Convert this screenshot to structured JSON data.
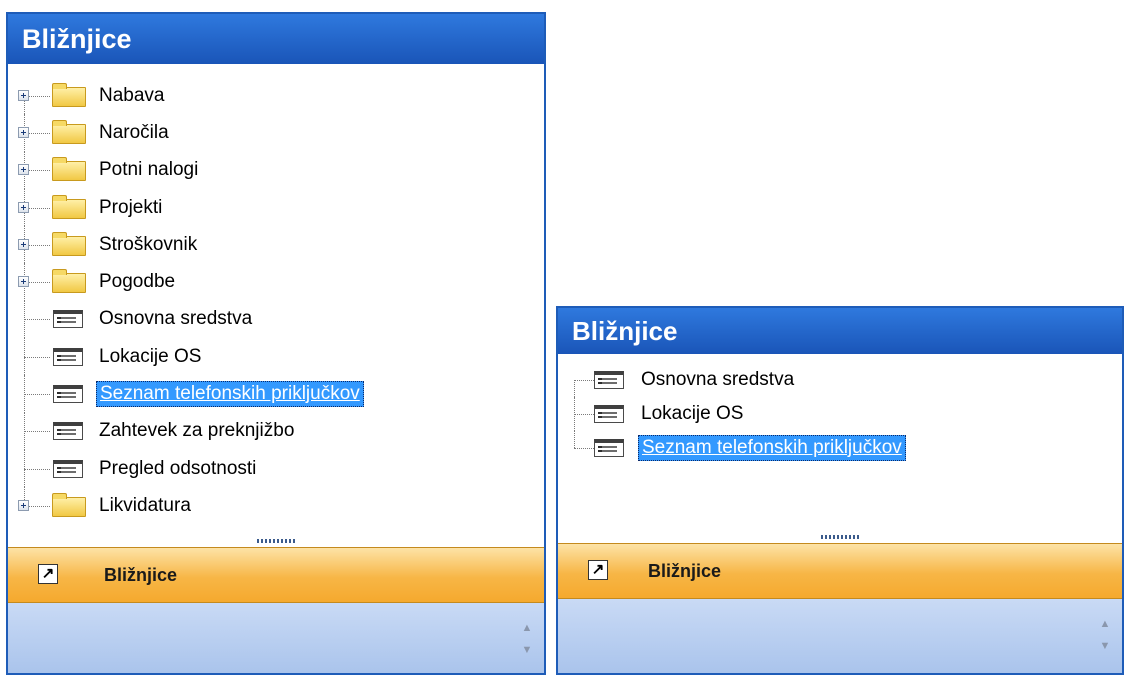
{
  "left_panel": {
    "title": "Bližnjice",
    "tree": [
      {
        "type": "folder",
        "label": "Nabava",
        "expandable": true
      },
      {
        "type": "folder",
        "label": "Naročila",
        "expandable": true
      },
      {
        "type": "folder",
        "label": "Potni nalogi",
        "expandable": true
      },
      {
        "type": "folder",
        "label": "Projekti",
        "expandable": true
      },
      {
        "type": "folder",
        "label": "Stroškovnik",
        "expandable": true
      },
      {
        "type": "folder",
        "label": "Pogodbe",
        "expandable": true
      },
      {
        "type": "form",
        "label": "Osnovna sredstva"
      },
      {
        "type": "form",
        "label": "Lokacije OS"
      },
      {
        "type": "form",
        "label": "Seznam telefonskih priključkov",
        "selected": true
      },
      {
        "type": "form",
        "label": "Zahtevek za preknjižbo"
      },
      {
        "type": "form",
        "label": "Pregled odsotnosti"
      },
      {
        "type": "folder",
        "label": "Likvidatura",
        "expandable": true
      }
    ],
    "nav_button_label": "Bližnjice"
  },
  "right_panel": {
    "title": "Bližnjice",
    "tree": [
      {
        "type": "form",
        "label": "Osnovna sredstva"
      },
      {
        "type": "form",
        "label": "Lokacije OS"
      },
      {
        "type": "form",
        "label": "Seznam telefonskih priključkov",
        "selected": true
      }
    ],
    "nav_button_label": "Bližnjice"
  },
  "icons": {
    "shortcut": "shortcut-arrow-icon",
    "folder": "folder-icon",
    "form": "form-icon",
    "expander": "plus-expander-icon"
  },
  "colors": {
    "title_bar": "#1a55b8",
    "selection": "#3399ff",
    "nav_button": "#f7b646",
    "footer": "#aac4ec"
  }
}
